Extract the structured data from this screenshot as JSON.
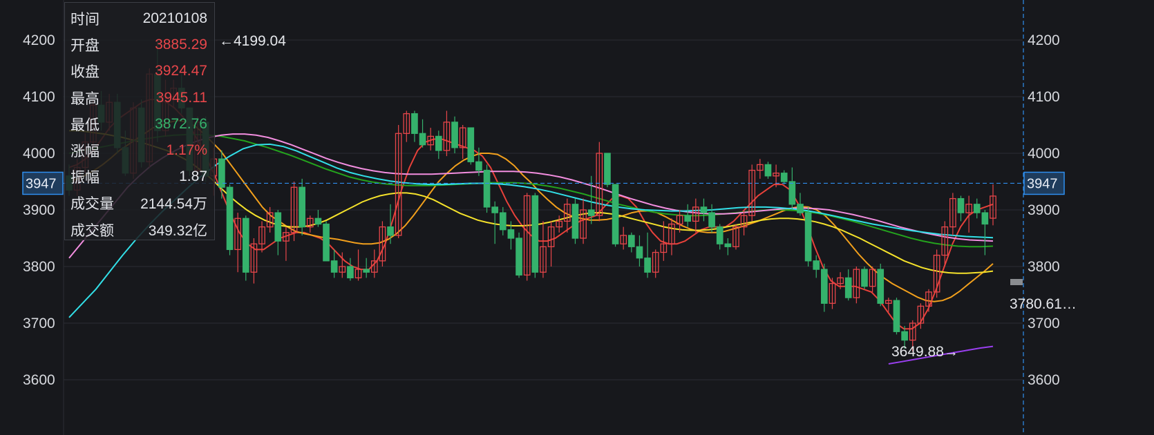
{
  "colors": {
    "background": "#17181c",
    "grid": "#2b2d33",
    "up": "#e8464a",
    "down": "#35b26c",
    "crosshair": "#2f8ff0",
    "price_tag_bg": "#1f3c5c"
  },
  "tooltip": {
    "rows": [
      {
        "label": "时间",
        "value": "20210108",
        "tone": "neutral"
      },
      {
        "label": "开盘",
        "value": "3885.29",
        "tone": "up"
      },
      {
        "label": "收盘",
        "value": "3924.47",
        "tone": "up"
      },
      {
        "label": "最高",
        "value": "3945.11",
        "tone": "up"
      },
      {
        "label": "最低",
        "value": "3872.76",
        "tone": "down"
      },
      {
        "label": "涨幅",
        "value": "1.17%",
        "tone": "up"
      },
      {
        "label": "振幅",
        "value": "1.87",
        "tone": "neutral"
      },
      {
        "label": "成交量",
        "value": "2144.54万",
        "tone": "neutral"
      },
      {
        "label": "成交额",
        "value": "349.32亿",
        "tone": "neutral"
      }
    ]
  },
  "crosshair": {
    "price_label": "3947",
    "price": 3947
  },
  "annotations": {
    "high": {
      "text": "←4199.04",
      "value": 4199.04
    },
    "low": {
      "text": "3649.88→",
      "value": 3649.88
    },
    "right_value": {
      "text": "3780.61…",
      "value": 3780.61
    }
  },
  "chart_data": {
    "type": "candlestick",
    "title": "",
    "xlabel": "",
    "ylabel": "",
    "ylim": [
      3560,
      4250
    ],
    "yticks": [
      3600,
      3700,
      3800,
      3900,
      4000,
      4100,
      4200
    ],
    "yticks_right": [
      3600,
      3700,
      3800,
      3900,
      4000,
      4100,
      4200
    ],
    "ohlc_order": "open,high,low,close",
    "candles": [
      [
        3960,
        3980,
        3925,
        3935
      ],
      [
        3935,
        3990,
        3925,
        3975
      ],
      [
        3975,
        4035,
        3965,
        4020
      ],
      [
        4020,
        4095,
        4005,
        4085
      ],
      [
        4085,
        4110,
        4040,
        4055
      ],
      [
        4055,
        4105,
        4040,
        4090
      ],
      [
        4090,
        4105,
        4000,
        4010
      ],
      [
        4010,
        4040,
        3960,
        3965
      ],
      [
        3965,
        4090,
        3955,
        4080
      ],
      [
        4080,
        4095,
        3975,
        3985
      ],
      [
        3985,
        4150,
        3975,
        4140
      ],
      [
        4140,
        4199.04,
        4020,
        4040
      ],
      [
        4040,
        4130,
        4030,
        4100
      ],
      [
        4100,
        4130,
        4080,
        4115
      ],
      [
        4115,
        4140,
        4070,
        4080
      ],
      [
        4080,
        4080,
        3960,
        3970
      ],
      [
        3970,
        4065,
        3955,
        4055
      ],
      [
        4055,
        4065,
        3950,
        3960
      ],
      [
        3960,
        4010,
        3925,
        3990
      ],
      [
        3990,
        4005,
        3920,
        3940
      ],
      [
        3940,
        3945,
        3820,
        3830
      ],
      [
        3830,
        3895,
        3790,
        3885
      ],
      [
        3885,
        3890,
        3775,
        3790
      ],
      [
        3790,
        3850,
        3770,
        3840
      ],
      [
        3840,
        3880,
        3825,
        3870
      ],
      [
        3870,
        3905,
        3860,
        3895
      ],
      [
        3895,
        3900,
        3820,
        3845
      ],
      [
        3845,
        3870,
        3810,
        3860
      ],
      [
        3860,
        3950,
        3845,
        3940
      ],
      [
        3940,
        3955,
        3855,
        3870
      ],
      [
        3870,
        3890,
        3860,
        3885
      ],
      [
        3885,
        3900,
        3870,
        3875
      ],
      [
        3875,
        3880,
        3810,
        3810
      ],
      [
        3810,
        3830,
        3780,
        3790
      ],
      [
        3790,
        3825,
        3780,
        3800
      ],
      [
        3800,
        3815,
        3775,
        3780
      ],
      [
        3780,
        3830,
        3775,
        3795
      ],
      [
        3795,
        3815,
        3780,
        3790
      ],
      [
        3790,
        3830,
        3780,
        3810
      ],
      [
        3810,
        3880,
        3800,
        3870
      ],
      [
        3870,
        3910,
        3840,
        3855
      ],
      [
        3855,
        4050,
        3850,
        4035
      ],
      [
        4035,
        4075,
        4020,
        4070
      ],
      [
        4070,
        4075,
        4020,
        4035
      ],
      [
        4035,
        4060,
        4010,
        4015
      ],
      [
        4015,
        4045,
        4005,
        4030
      ],
      [
        4030,
        4040,
        3990,
        4005
      ],
      [
        4005,
        4075,
        3995,
        4055
      ],
      [
        4055,
        4065,
        4000,
        4010
      ],
      [
        4010,
        4050,
        3990,
        4045
      ],
      [
        4045,
        4045,
        3980,
        3985
      ],
      [
        3985,
        4010,
        3960,
        3970
      ],
      [
        3970,
        3980,
        3895,
        3905
      ],
      [
        3905,
        3915,
        3840,
        3895
      ],
      [
        3895,
        3905,
        3855,
        3865
      ],
      [
        3865,
        3880,
        3830,
        3850
      ],
      [
        3850,
        3860,
        3780,
        3785
      ],
      [
        3785,
        3930,
        3775,
        3925
      ],
      [
        3925,
        3930,
        3780,
        3790
      ],
      [
        3790,
        3880,
        3780,
        3835
      ],
      [
        3835,
        3880,
        3800,
        3870
      ],
      [
        3870,
        3890,
        3860,
        3880
      ],
      [
        3880,
        3920,
        3860,
        3910
      ],
      [
        3910,
        3920,
        3840,
        3850
      ],
      [
        3850,
        3920,
        3840,
        3900
      ],
      [
        3900,
        3960,
        3875,
        3890
      ],
      [
        3890,
        4020,
        3880,
        4000
      ],
      [
        4000,
        4000,
        3940,
        3945
      ],
      [
        3945,
        3945,
        3835,
        3840
      ],
      [
        3840,
        3870,
        3830,
        3855
      ],
      [
        3855,
        3860,
        3825,
        3835
      ],
      [
        3835,
        3855,
        3800,
        3815
      ],
      [
        3815,
        3860,
        3780,
        3790
      ],
      [
        3790,
        3830,
        3780,
        3825
      ],
      [
        3825,
        3880,
        3810,
        3840
      ],
      [
        3840,
        3885,
        3820,
        3875
      ],
      [
        3875,
        3900,
        3860,
        3890
      ],
      [
        3890,
        3910,
        3870,
        3880
      ],
      [
        3880,
        3920,
        3860,
        3905
      ],
      [
        3905,
        3920,
        3880,
        3895
      ],
      [
        3895,
        3910,
        3860,
        3870
      ],
      [
        3870,
        3875,
        3830,
        3840
      ],
      [
        3840,
        3850,
        3820,
        3835
      ],
      [
        3835,
        3875,
        3830,
        3870
      ],
      [
        3870,
        3900,
        3855,
        3890
      ],
      [
        3890,
        3980,
        3880,
        3970
      ],
      [
        3970,
        3990,
        3955,
        3980
      ],
      [
        3980,
        3985,
        3955,
        3960
      ],
      [
        3960,
        3980,
        3940,
        3965
      ],
      [
        3965,
        3970,
        3945,
        3950
      ],
      [
        3950,
        3975,
        3900,
        3910
      ],
      [
        3910,
        3930,
        3890,
        3895
      ],
      [
        3895,
        3905,
        3800,
        3810
      ],
      [
        3810,
        3820,
        3780,
        3795
      ],
      [
        3795,
        3805,
        3720,
        3735
      ],
      [
        3735,
        3780,
        3725,
        3770
      ],
      [
        3770,
        3790,
        3760,
        3780
      ],
      [
        3780,
        3795,
        3740,
        3745
      ],
      [
        3745,
        3800,
        3735,
        3795
      ],
      [
        3795,
        3800,
        3760,
        3765
      ],
      [
        3765,
        3800,
        3755,
        3795
      ],
      [
        3795,
        3805,
        3730,
        3735
      ],
      [
        3735,
        3745,
        3720,
        3740
      ],
      [
        3740,
        3745,
        3680,
        3685
      ],
      [
        3685,
        3695,
        3655,
        3670
      ],
      [
        3670,
        3705,
        3649.88,
        3700
      ],
      [
        3700,
        3735,
        3690,
        3730
      ],
      [
        3730,
        3760,
        3720,
        3755
      ],
      [
        3755,
        3830,
        3745,
        3820
      ],
      [
        3820,
        3880,
        3800,
        3870
      ],
      [
        3870,
        3930,
        3855,
        3920
      ],
      [
        3920,
        3925,
        3880,
        3895
      ],
      [
        3895,
        3925,
        3860,
        3910
      ],
      [
        3910,
        3920,
        3885,
        3895
      ],
      [
        3895,
        3900,
        3820,
        3875
      ],
      [
        3885.29,
        3945.11,
        3872.76,
        3924.47
      ]
    ],
    "moving_averages": [
      {
        "color": "#e8413a",
        "values": [
          3975,
          3980,
          3990,
          4005,
          4025,
          4045,
          4060,
          4070,
          4080,
          4090,
          4095,
          4095,
          4090,
          4080,
          4065,
          4045,
          4020,
          3990,
          3960,
          3925,
          3890,
          3860,
          3840,
          3830,
          3830,
          3840,
          3850,
          3855,
          3860,
          3860,
          3855,
          3850,
          3840,
          3825,
          3810,
          3800,
          3795,
          3795,
          3810,
          3840,
          3885,
          3935,
          3975,
          4005,
          4020,
          4025,
          4025,
          4020,
          4015,
          4010,
          4005,
          3995,
          3975,
          3945,
          3915,
          3890,
          3870,
          3855,
          3845,
          3845,
          3850,
          3860,
          3870,
          3880,
          3885,
          3890,
          3905,
          3920,
          3925,
          3920,
          3905,
          3880,
          3860,
          3845,
          3840,
          3840,
          3845,
          3855,
          3865,
          3870,
          3870,
          3870,
          3880,
          3895,
          3910,
          3925,
          3935,
          3945,
          3945,
          3935,
          3910,
          3875,
          3835,
          3800,
          3775,
          3765,
          3765,
          3765,
          3760,
          3755,
          3740,
          3720,
          3700,
          3690,
          3690,
          3700,
          3725,
          3760,
          3800,
          3840,
          3870,
          3890,
          3900,
          3905,
          3910
        ]
      },
      {
        "color": "#f2a01c",
        "values": [
          3950,
          3955,
          3962,
          3970,
          3980,
          3992,
          4005,
          4015,
          4025,
          4035,
          4045,
          4050,
          4055,
          4058,
          4055,
          4048,
          4035,
          4020,
          4005,
          3985,
          3965,
          3945,
          3925,
          3905,
          3890,
          3880,
          3870,
          3862,
          3858,
          3855,
          3852,
          3850,
          3848,
          3845,
          3842,
          3840,
          3840,
          3842,
          3848,
          3858,
          3872,
          3890,
          3910,
          3930,
          3950,
          3965,
          3978,
          3988,
          3995,
          4000,
          4000,
          3998,
          3990,
          3978,
          3962,
          3948,
          3932,
          3918,
          3905,
          3895,
          3888,
          3885,
          3882,
          3882,
          3883,
          3886,
          3890,
          3895,
          3898,
          3898,
          3895,
          3888,
          3880,
          3872,
          3866,
          3862,
          3860,
          3860,
          3862,
          3866,
          3870,
          3875,
          3880,
          3886,
          3892,
          3898,
          3903,
          3906,
          3905,
          3900,
          3890,
          3875,
          3858,
          3840,
          3822,
          3806,
          3792,
          3780,
          3770,
          3762,
          3754,
          3746,
          3740,
          3738,
          3740,
          3746,
          3756,
          3768,
          3780,
          3792,
          3805
        ]
      },
      {
        "color": "#f5e22b",
        "values": [
          4040,
          4040,
          4038,
          4036,
          4034,
          4031,
          4028,
          4024,
          4020,
          4015,
          4010,
          4005,
          3998,
          3990,
          3980,
          3968,
          3955,
          3940,
          3925,
          3912,
          3900,
          3890,
          3882,
          3876,
          3872,
          3870,
          3870,
          3872,
          3876,
          3882,
          3890,
          3898,
          3906,
          3914,
          3920,
          3925,
          3928,
          3930,
          3930,
          3928,
          3924,
          3918,
          3910,
          3902,
          3894,
          3888,
          3882,
          3878,
          3875,
          3873,
          3872,
          3872,
          3873,
          3875,
          3878,
          3882,
          3886,
          3890,
          3893,
          3895,
          3895,
          3893,
          3890,
          3886,
          3882,
          3878,
          3874,
          3870,
          3867,
          3865,
          3864,
          3864,
          3865,
          3867,
          3870,
          3873,
          3876,
          3879,
          3882,
          3884,
          3885,
          3885,
          3884,
          3882,
          3879,
          3875,
          3870,
          3864,
          3857,
          3850,
          3842,
          3834,
          3826,
          3818,
          3810,
          3804,
          3798,
          3794,
          3791,
          3789,
          3788,
          3788,
          3789,
          3790,
          3792
        ]
      },
      {
        "color": "#24a31d",
        "values": [
          4000,
          4004,
          4008,
          4012,
          4016,
          4020,
          4024,
          4027,
          4030,
          4032,
          4033,
          4033,
          4032,
          4030,
          4026,
          4022,
          4016,
          4010,
          4003,
          3996,
          3988,
          3980,
          3972,
          3965,
          3958,
          3953,
          3949,
          3946,
          3944,
          3943,
          3943,
          3943,
          3944,
          3945,
          3946,
          3947,
          3948,
          3948,
          3948,
          3947,
          3945,
          3942,
          3938,
          3933,
          3928,
          3922,
          3916,
          3910,
          3905,
          3900,
          3896,
          3893,
          3891,
          3890,
          3890,
          3891,
          3893,
          3895,
          3897,
          3899,
          3900,
          3900,
          3899,
          3897,
          3894,
          3890,
          3885,
          3880,
          3874,
          3868,
          3862,
          3856,
          3850,
          3845,
          3841,
          3838,
          3836,
          3835,
          3835,
          3836
        ]
      },
      {
        "color": "#f38ee0",
        "values": [
          3815,
          3840,
          3865,
          3890,
          3915,
          3940,
          3960,
          3978,
          3992,
          4004,
          4014,
          4022,
          4028,
          4032,
          4034,
          4034,
          4032,
          4028,
          4022,
          4015,
          4007,
          3999,
          3991,
          3984,
          3978,
          3973,
          3969,
          3966,
          3964,
          3963,
          3963,
          3963,
          3964,
          3965,
          3966,
          3967,
          3968,
          3968,
          3968,
          3967,
          3965,
          3962,
          3958,
          3953,
          3947,
          3941,
          3934,
          3927,
          3920,
          3914,
          3908,
          3903,
          3899,
          3896,
          3894,
          3893,
          3893,
          3894,
          3896,
          3898,
          3900,
          3902,
          3903,
          3903,
          3902,
          3900,
          3896,
          3892,
          3887,
          3882,
          3876,
          3870,
          3865,
          3860,
          3856,
          3852,
          3849,
          3847,
          3846,
          3845
        ]
      },
      {
        "color": "#32e0e8",
        "values": [
          3710,
          3735,
          3760,
          3790,
          3820,
          3848,
          3874,
          3898,
          3920,
          3942,
          3962,
          3980,
          3995,
          4008,
          4015,
          4016,
          4012,
          4004,
          3994,
          3984,
          3974,
          3966,
          3960,
          3955,
          3951,
          3948,
          3946,
          3945,
          3945,
          3946,
          3947,
          3947,
          3946,
          3944,
          3941,
          3937,
          3932,
          3926,
          3920,
          3914,
          3909,
          3905,
          3902,
          3900,
          3899,
          3898,
          3898,
          3899,
          3900,
          3902,
          3904,
          3905,
          3905,
          3904,
          3902,
          3899,
          3895,
          3890,
          3885,
          3880,
          3875,
          3871,
          3867,
          3863,
          3860,
          3857,
          3855,
          3853,
          3852,
          3851
        ]
      },
      {
        "color": "#9a3ff0",
        "values": [
          3628,
          3632,
          3636,
          3640,
          3644,
          3648,
          3652,
          3656,
          3659
        ]
      }
    ]
  }
}
